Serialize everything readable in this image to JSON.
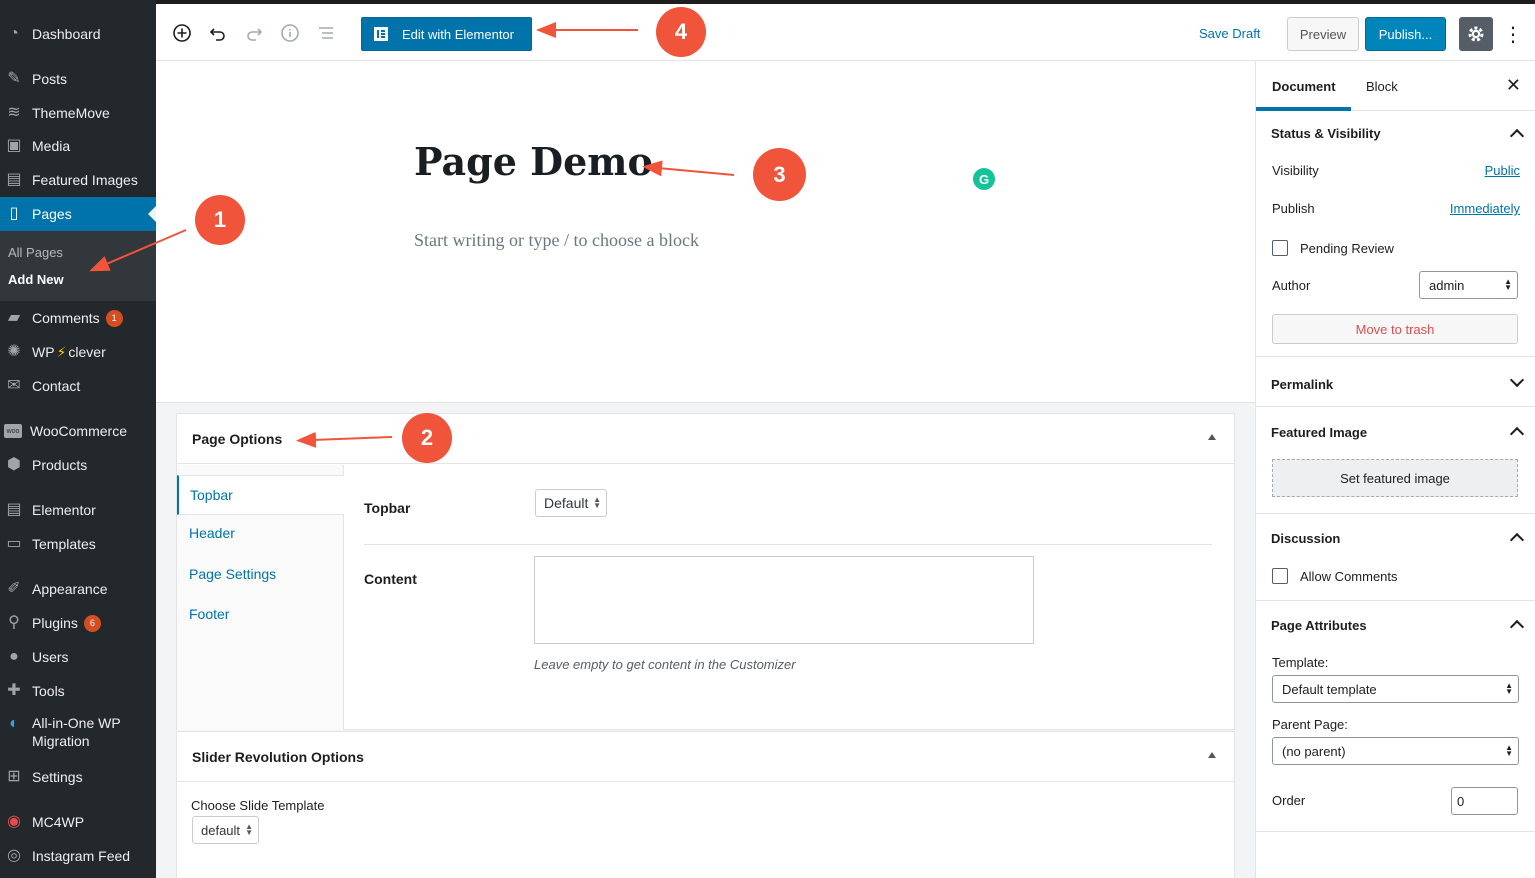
{
  "sidebar": {
    "items": [
      {
        "label": "Dashboard",
        "icon": "dashboard-icon",
        "glyph": "◔"
      },
      {
        "label": "Posts",
        "icon": "pin-icon",
        "glyph": "✎"
      },
      {
        "label": "ThemeMove",
        "icon": "thememove-icon",
        "glyph": "≋"
      },
      {
        "label": "Media",
        "icon": "media-icon",
        "glyph": "▣"
      },
      {
        "label": "Featured Images",
        "icon": "images-icon",
        "glyph": "▤"
      },
      {
        "label": "Pages",
        "icon": "pages-icon",
        "glyph": "▯"
      },
      {
        "label": "Comments",
        "icon": "comment-icon",
        "glyph": "▰",
        "badge": "1"
      },
      {
        "label": "WP",
        "icon": "lightbulb-icon",
        "glyph": "✺",
        "extra_glyph": "⚡",
        "suffix": "clever"
      },
      {
        "label": "Contact",
        "icon": "mail-icon",
        "glyph": "✉"
      },
      {
        "label": "WooCommerce",
        "icon": "woo-icon",
        "glyph": "woo"
      },
      {
        "label": "Products",
        "icon": "box-icon",
        "glyph": "⬢"
      },
      {
        "label": "Elementor",
        "icon": "elementor-icon",
        "glyph": "▤"
      },
      {
        "label": "Templates",
        "icon": "folder-icon",
        "glyph": "▭"
      },
      {
        "label": "Appearance",
        "icon": "brush-icon",
        "glyph": "✐"
      },
      {
        "label": "Plugins",
        "icon": "plug-icon",
        "glyph": "⚲",
        "badge": "6"
      },
      {
        "label": "Users",
        "icon": "user-icon",
        "glyph": "●"
      },
      {
        "label": "Tools",
        "icon": "wrench-icon",
        "glyph": "✚"
      },
      {
        "label": "All-in-One WP",
        "label2": "Migration",
        "icon": "migration-icon",
        "glyph": "◐"
      },
      {
        "label": "Settings",
        "icon": "settings-icon",
        "glyph": "⊞"
      },
      {
        "label": "MC4WP",
        "icon": "mc4wp-icon",
        "glyph": "◉"
      },
      {
        "label": "Instagram Feed",
        "icon": "instagram-icon",
        "glyph": "◎"
      }
    ],
    "submenu": {
      "all_pages": "All Pages",
      "add_new": "Add New"
    }
  },
  "topbar": {
    "elementor_label": "Edit with Elementor",
    "save_draft": "Save Draft",
    "preview": "Preview",
    "publish": "Publish...",
    "more": "⋮"
  },
  "editor": {
    "title": "Page Demo",
    "placeholder": "Start writing or type / to choose a block",
    "grammarly": "G"
  },
  "page_options": {
    "title": "Page Options",
    "tabs": [
      "Topbar",
      "Header",
      "Page Settings",
      "Footer"
    ],
    "topbar_label": "Topbar",
    "topbar_value": "Default",
    "content_label": "Content",
    "hint": "Leave empty to get content in the Customizer"
  },
  "slider": {
    "title": "Slider Revolution Options",
    "label": "Choose Slide Template",
    "value": "default"
  },
  "right_panel": {
    "tab_document": "Document",
    "tab_block": "Block",
    "close": "✕",
    "status_title": "Status & Visibility",
    "visibility_label": "Visibility",
    "visibility_value": "Public",
    "publish_label": "Publish",
    "publish_value": "Immediately",
    "pending_review": "Pending Review",
    "author_label": "Author",
    "author_value": "admin",
    "move_trash": "Move to trash",
    "permalink_title": "Permalink",
    "featured_title": "Featured Image",
    "set_featured": "Set featured image",
    "discussion_title": "Discussion",
    "allow_comments": "Allow Comments",
    "attributes_title": "Page Attributes",
    "template_label": "Template:",
    "template_value": "Default template",
    "parent_label": "Parent Page:",
    "parent_value": "(no parent)",
    "order_label": "Order",
    "order_value": "0"
  },
  "callouts": [
    "1",
    "2",
    "3",
    "4"
  ],
  "colors": {
    "accent": "#0073aa",
    "callout": "#f0543a",
    "sidebar": "#23282d"
  }
}
